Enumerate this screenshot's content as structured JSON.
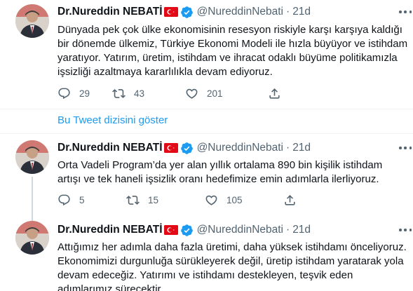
{
  "author": {
    "name": "Dr.Nureddin NEBATİ",
    "handle": "@NureddinNebati",
    "flag_icon": "turkey-flag-icon",
    "verified_icon": "verified-badge-icon"
  },
  "colors": {
    "accent": "#1d9bf0",
    "secondary_text": "#536471",
    "flag_red": "#e30a17",
    "divider": "#eff3f4"
  },
  "tweets": [
    {
      "time": "21d",
      "text": "Dünyada pek çok ülke ekonomisinin resesyon riskiyle karşı karşıya kaldığı bir dönemde ülkemiz, Türkiye Ekonomi Modeli ile hızla büyüyor ve istihdam yaratıyor. Yatırım, üretim, istihdam ve ihracat odaklı büyüme politikamızla işsizliği azaltmaya kararlılıkla devam ediyoruz.",
      "replies": "29",
      "retweets": "43",
      "likes": "201"
    },
    {
      "time": "21d",
      "text": "Orta Vadeli Program’da yer alan yıllık ortalama 890 bin kişilik istihdam artışı ve tek haneli işsizlik oranı hedefimize emin adımlarla ilerliyoruz.",
      "replies": "5",
      "retweets": "15",
      "likes": "105"
    },
    {
      "time": "21d",
      "text": "Attığımız her adımla daha fazla üretimi, daha yüksek istihdamı önceliyoruz. Ekonomimizi durgunluğa sürükleyerek değil, üretip istihdam yaratarak yola devam edeceğiz. Yatırımı ve istihdamı destekleyen, teşvik eden adımlarımız sürecektir."
    }
  ],
  "show_thread_label": "Bu Tweet dizisini göster"
}
